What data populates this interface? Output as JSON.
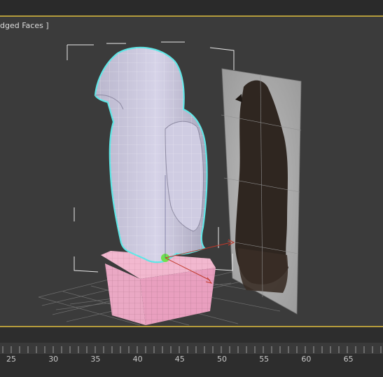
{
  "viewport": {
    "label": "dged Faces ]",
    "model_name": "bird statue mesh",
    "reference_plane": "falcon reference image"
  },
  "colors": {
    "selection": "#5fe6e6",
    "mesh": "#c9c6dc",
    "base": "#f0b0c8",
    "grid": "#7a7a7a",
    "viewport_border": "#b49b3c"
  },
  "timeline": {
    "frame_labels": [
      "25",
      "30",
      "35",
      "40",
      "45",
      "50",
      "55",
      "60",
      "65"
    ]
  }
}
